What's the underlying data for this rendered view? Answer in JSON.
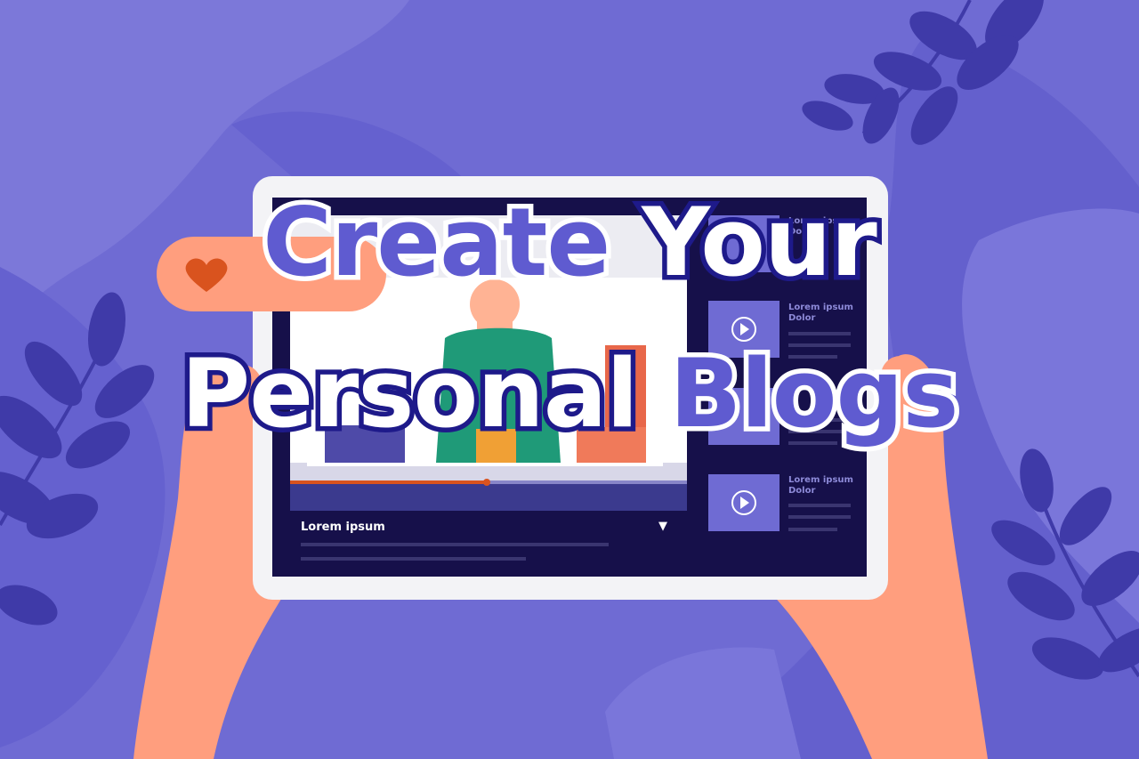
{
  "headline": {
    "line1_part1": "Create",
    "line1_part2": "Your",
    "line2_part1": "Personal",
    "line2_part2": "Blogs"
  },
  "video": {
    "title": "Lorem ipsum",
    "progress": 0.5
  },
  "playlist": [
    {
      "title_line1": "Lorem ipsum",
      "title_line2": "Dolor"
    },
    {
      "title_line1": "Lorem ipsum",
      "title_line2": "Dolor"
    },
    {
      "title_line1": "Lorem ipsum",
      "title_line2": "Dolor"
    }
  ],
  "icons": [
    "heart-icon",
    "play-icon",
    "dropdown-arrow-icon",
    "leaf-icon"
  ],
  "colors": {
    "background": "#6f6bd3",
    "screen": "#16104a",
    "hand": "#ff9e7e",
    "accent_purple": "#5f5bd0",
    "heart": "#d9531e"
  }
}
